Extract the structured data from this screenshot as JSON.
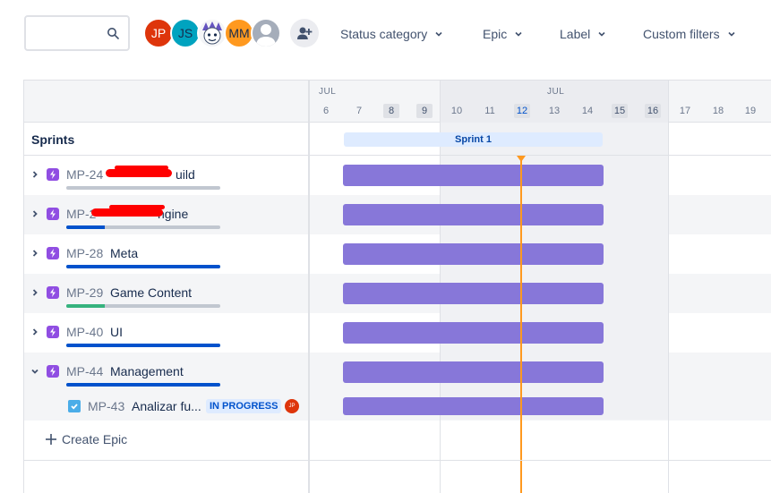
{
  "toolbar": {
    "search_placeholder": "",
    "avatars": [
      {
        "initials": "JP",
        "color": "#de350b"
      },
      {
        "initials": "JS",
        "color": "#00a3bf"
      },
      {
        "initials": "",
        "color": "#f4f5f7"
      },
      {
        "initials": "MM",
        "color": "#ff991f"
      },
      {
        "initials": "",
        "color": "#a5adba"
      }
    ],
    "filters": {
      "status_category": "Status category",
      "epic": "Epic",
      "label": "Label",
      "custom_filters": "Custom filters"
    }
  },
  "timeline": {
    "months": [
      "JUL",
      "JUL"
    ],
    "days": [
      "6",
      "7",
      "8",
      "9",
      "10",
      "11",
      "12",
      "13",
      "14",
      "15",
      "16",
      "17",
      "18",
      "19"
    ],
    "sprints_label": "Sprints",
    "sprint_name": "Sprint 1",
    "today_color": "#ff991f",
    "bar_color": "#8777d9"
  },
  "epics": [
    {
      "key": "MP-24",
      "name": "uild",
      "progress_done": 0,
      "progress_in_progress": 0
    },
    {
      "key": "MP-2",
      "name": "ngine",
      "progress_done": 0,
      "progress_in_progress": 0.25
    },
    {
      "key": "MP-28",
      "name": "Meta",
      "progress_done": 0,
      "progress_in_progress": 1.0
    },
    {
      "key": "MP-29",
      "name": "Game Content",
      "progress_done": 0.25,
      "progress_in_progress": 0
    },
    {
      "key": "MP-40",
      "name": "UI",
      "progress_done": 0,
      "progress_in_progress": 1.0
    },
    {
      "key": "MP-44",
      "name": "Management",
      "progress_done": 0,
      "progress_in_progress": 1.0
    }
  ],
  "child_issue": {
    "key": "MP-43",
    "name": "Analizar fu...",
    "status": "IN PROGRESS",
    "assignee_initials": "JP"
  },
  "create_epic_label": "Create Epic"
}
